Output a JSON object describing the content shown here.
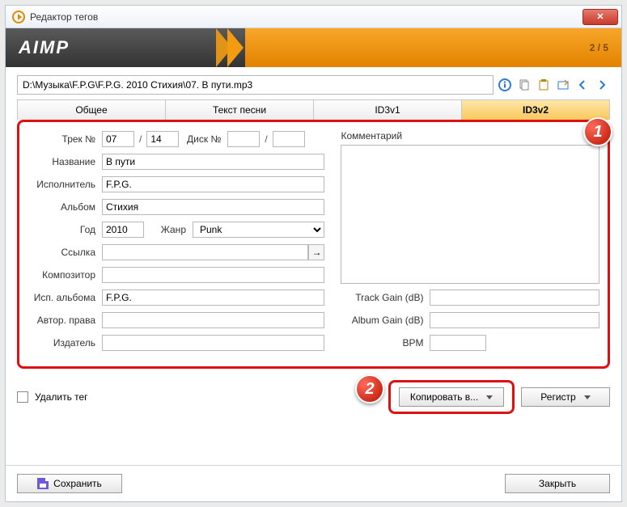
{
  "window": {
    "title": "Редактор тегов"
  },
  "header": {
    "logo": "AIMP",
    "counter": "2 / 5"
  },
  "path": {
    "value": "D:\\Музыка\\F.P.G\\F.P.G. 2010 Стихия\\07. В пути.mp3"
  },
  "tabs": [
    "Общее",
    "Текст песни",
    "ID3v1",
    "ID3v2"
  ],
  "labels": {
    "track_no": "Трек №",
    "disc_no": "Диск №",
    "title": "Название",
    "artist": "Исполнитель",
    "album": "Альбом",
    "year": "Год",
    "genre": "Жанр",
    "url": "Ссылка",
    "composer": "Композитор",
    "album_artist": "Исп. альбома",
    "copyright": "Автор. права",
    "publisher": "Издатель",
    "comment": "Комментарий",
    "track_gain": "Track Gain (dB)",
    "album_gain": "Album Gain (dB)",
    "bpm": "BPM",
    "delete_tag": "Удалить тег"
  },
  "values": {
    "track": "07",
    "track_total": "14",
    "disc": "",
    "disc_total": "",
    "title": "В пути",
    "artist": "F.P.G.",
    "album": "Стихия",
    "year": "2010",
    "genre": "Punk",
    "url": "",
    "composer": "",
    "album_artist": "F.P.G.",
    "copyright": "",
    "publisher": "",
    "comment": "",
    "track_gain": "",
    "album_gain": "",
    "bpm": ""
  },
  "buttons": {
    "copy_to": "Копировать в...",
    "case": "Регистр",
    "save": "Сохранить",
    "close": "Закрыть"
  },
  "badges": {
    "one": "1",
    "two": "2"
  }
}
